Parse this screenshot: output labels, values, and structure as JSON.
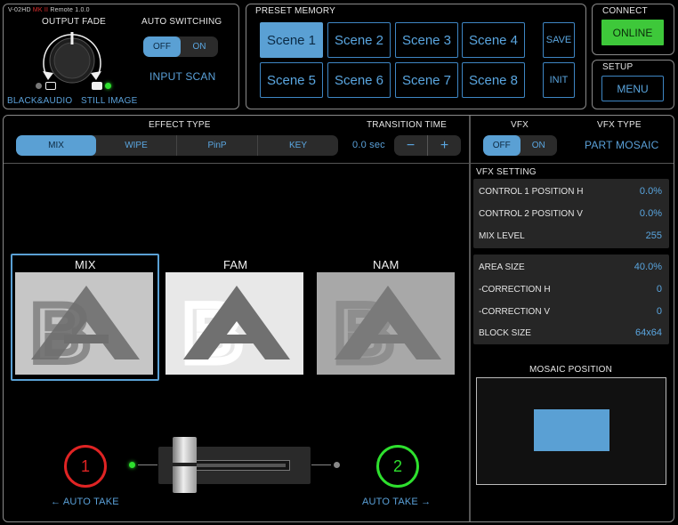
{
  "app": {
    "title_prefix": "V-02HD ",
    "title_mk": "MK II",
    "title_suffix": " Remote 1.0.0"
  },
  "output_fade": {
    "label": "OUTPUT FADE",
    "left_label": "BLACK&AUDIO",
    "right_label": "STILL IMAGE"
  },
  "auto_switching": {
    "label": "AUTO SWITCHING",
    "off": "OFF",
    "on": "ON",
    "state": "OFF",
    "input_scan": "INPUT SCAN"
  },
  "preset_memory": {
    "label": "PRESET MEMORY",
    "scenes": [
      "Scene 1",
      "Scene 2",
      "Scene 3",
      "Scene 4",
      "Scene 5",
      "Scene 6",
      "Scene 7",
      "Scene 8"
    ],
    "active": "Scene 1",
    "save": "SAVE",
    "init": "INIT"
  },
  "connect": {
    "label": "CONNECT",
    "button": "ONLINE",
    "color": "#3ec83a"
  },
  "setup": {
    "label": "SETUP",
    "button": "MENU"
  },
  "effect_type": {
    "label": "EFFECT TYPE",
    "options": [
      "MIX",
      "WIPE",
      "PinP",
      "KEY"
    ],
    "selected": "MIX"
  },
  "transition_time": {
    "label": "TRANSITION TIME",
    "value": "0.0 sec",
    "minus": "−",
    "plus": "+"
  },
  "vfx": {
    "label": "VFX",
    "off": "OFF",
    "on": "ON",
    "state": "OFF",
    "type_label": "VFX TYPE",
    "type_value": "PART MOSAIC"
  },
  "vfx_setting": {
    "label": "VFX SETTING",
    "group1": [
      {
        "name": "CONTROL 1 POSITION H",
        "value": "0.0%"
      },
      {
        "name": "CONTROL 2 POSITION V",
        "value": "0.0%"
      },
      {
        "name": "MIX LEVEL",
        "value": "255"
      }
    ],
    "group2": [
      {
        "name": "AREA SIZE",
        "value": "40.0%"
      },
      {
        "name": "-CORRECTION H",
        "value": "0"
      },
      {
        "name": "-CORRECTION V",
        "value": "0"
      },
      {
        "name": "BLOCK SIZE",
        "value": "64x64"
      }
    ],
    "mosaic_position": "MOSAIC POSITION"
  },
  "previews": [
    {
      "label": "MIX",
      "selected": true
    },
    {
      "label": "FAM",
      "selected": false
    },
    {
      "label": "NAM",
      "selected": false
    }
  ],
  "take": {
    "left_number": "1",
    "left_label": "← AUTO TAKE",
    "left_color": "#e02424",
    "right_number": "2",
    "right_label": "AUTO TAKE →",
    "right_color": "#2ee02e"
  },
  "colors": {
    "accent": "#5aa0d4",
    "panel_border": "#8a8a8a"
  }
}
